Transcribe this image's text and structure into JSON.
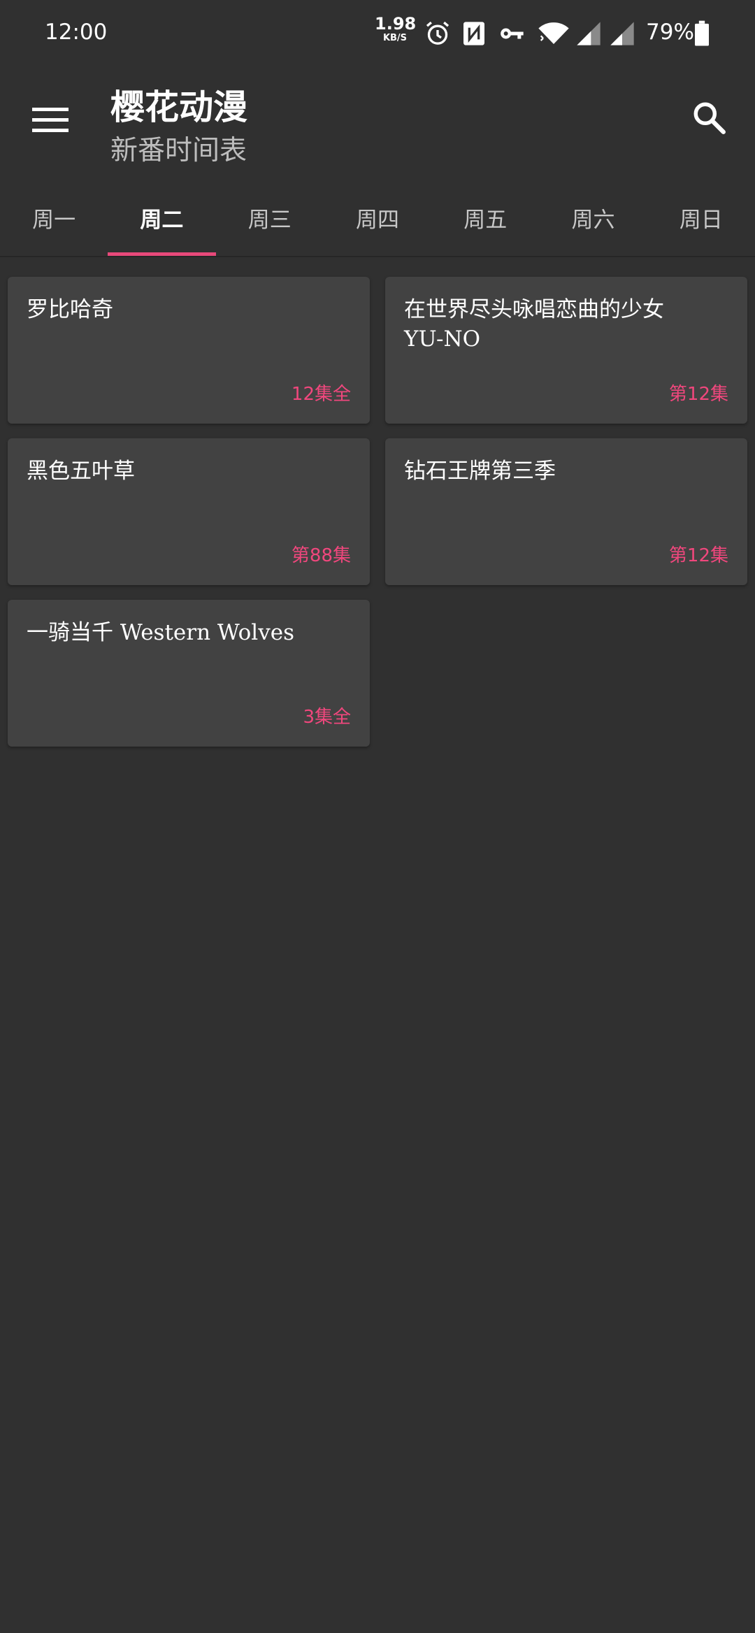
{
  "status_bar": {
    "time": "12:00",
    "net_speed_value": "1.98",
    "net_speed_unit": "KB/S",
    "battery_percent": "79%",
    "icons": [
      "alarm-icon",
      "nfc-icon",
      "vpn-key-icon",
      "wifi-icon",
      "signal-icon",
      "signal-icon",
      "battery-icon"
    ]
  },
  "app_bar": {
    "title": "樱花动漫",
    "subtitle": "新番时间表",
    "menu_icon": "menu-icon",
    "search_icon": "search-icon"
  },
  "tabs": [
    {
      "label": "周一",
      "active": false
    },
    {
      "label": "周二",
      "active": true
    },
    {
      "label": "周三",
      "active": false
    },
    {
      "label": "周四",
      "active": false
    },
    {
      "label": "周五",
      "active": false
    },
    {
      "label": "周六",
      "active": false
    },
    {
      "label": "周日",
      "active": false
    }
  ],
  "cards": [
    {
      "title": "罗比哈奇",
      "episode": "12集全"
    },
    {
      "title": "在世界尽头咏唱恋曲的少女\nYU-NO",
      "episode": "第12集"
    },
    {
      "title": "黑色五叶草",
      "episode": "第88集"
    },
    {
      "title": "钻石王牌第三季",
      "episode": "第12集"
    },
    {
      "title": "一骑当千 Western Wolves",
      "episode": "3集全"
    }
  ],
  "colors": {
    "background": "#303030",
    "card": "#424242",
    "accent": "#e8497a",
    "episode_text": "#f0477d"
  }
}
